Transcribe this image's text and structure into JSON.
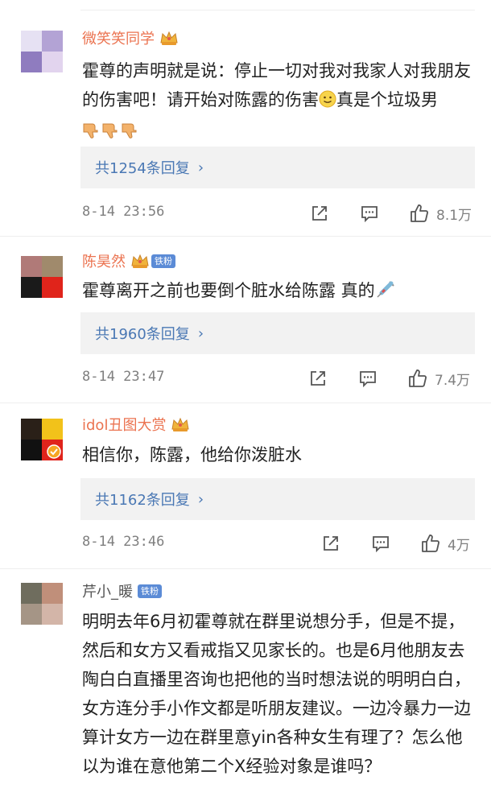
{
  "colors": {
    "username_vip": "#eb7350",
    "reply_link": "#4a78b4",
    "fan_badge": "#5b8bd6",
    "meta_gray": "#7f7f7f"
  },
  "comments": [
    {
      "username": "微笑笑同学",
      "badge_icon": "crown-icon",
      "text_before_emoji": "霍尊的声明就是说：停止一切对我对我家人对我朋友的伤害吧！请开始对陈露的伤害",
      "emoji1": "slight-smile-emoji",
      "text_after_emoji": "真是个垃圾男",
      "emoji2": "thumbs-down-emoji x3",
      "replies": "共1254条回复",
      "time": "8-14 23:56",
      "likes": "8.1万"
    },
    {
      "username": "陈昊然",
      "badge_icon": "crown-icon",
      "fan_label": "铁粉",
      "text": "霍尊离开之前也要倒个脏水给陈露 真的",
      "emoji": "syringe-emoji",
      "replies": "共1960条回复",
      "time": "8-14 23:47",
      "likes": "7.4万"
    },
    {
      "username": "idol丑图大赏",
      "badge_icon": "crown-icon",
      "text": "相信你，陈露，他给你泼脏水",
      "replies": "共1162条回复",
      "time": "8-14 23:46",
      "likes": "4万"
    },
    {
      "username": "芹小_暖",
      "fan_label": "铁粉",
      "text": "明明去年6月初霍尊就在群里说想分手，但是不提，然后和女方又看戒指又见家长的。也是6月他朋友去陶白白直播里咨询也把他的当时想法说的明明白白，女方连分手小作文都是听朋友建议。一边冷暴力一边算计女方一边在群里意yin各种女生有理了？怎么他以为谁在意他第二个X经验对象是谁吗？"
    }
  ]
}
